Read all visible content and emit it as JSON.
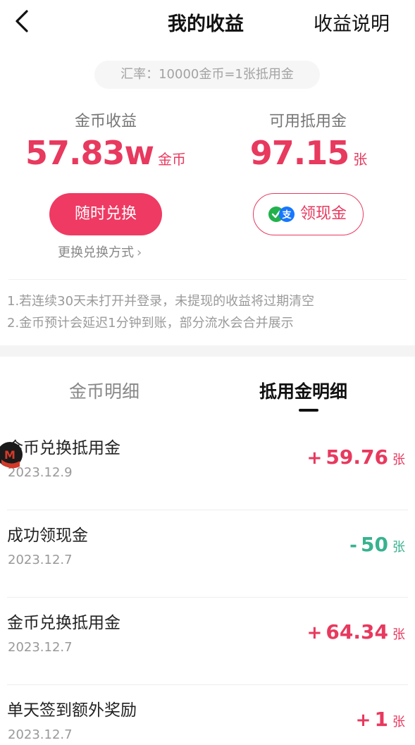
{
  "header": {
    "title": "我的收益",
    "right_link": "收益说明"
  },
  "rate_text": "汇率：10000金币=1张抵用金",
  "stats": {
    "coins": {
      "label": "金币收益",
      "value": "57.83w",
      "unit": "金币"
    },
    "voucher": {
      "label": "可用抵用金",
      "value": "97.15",
      "unit": "张"
    }
  },
  "actions": {
    "exchange_label": "随时兑换",
    "cash_label": "领现金",
    "change_method_label": "更换兑换方式",
    "chevron": "›"
  },
  "notes": [
    "1.若连续30天未打开并登录，未提现的收益将过期清空",
    "2.金币预计会延迟1分钟到账，部分流水会合并展示"
  ],
  "tabs": [
    {
      "label": "金币明细",
      "active": false
    },
    {
      "label": "抵用金明细",
      "active": true
    }
  ],
  "records": [
    {
      "title": "金币兑换抵用金",
      "date": "2023.12.9",
      "sign": "+",
      "amount": "59.76",
      "unit": "张",
      "type": "pos"
    },
    {
      "title": "成功领现金",
      "date": "2023.12.7",
      "sign": "-",
      "amount": "50",
      "unit": "张",
      "type": "neg"
    },
    {
      "title": "金币兑换抵用金",
      "date": "2023.12.7",
      "sign": "+",
      "amount": "64.34",
      "unit": "张",
      "type": "pos"
    },
    {
      "title": "单天签到额外奖励",
      "date": "2023.12.7",
      "sign": "+",
      "amount": "1",
      "unit": "张",
      "type": "pos"
    }
  ],
  "colors": {
    "accent": "#e8395e",
    "negative": "#38b28f",
    "button": "#ef3a63"
  },
  "icons": {
    "back": "chevron-left-icon",
    "cash": "wechat-pay-alipay-icon"
  }
}
